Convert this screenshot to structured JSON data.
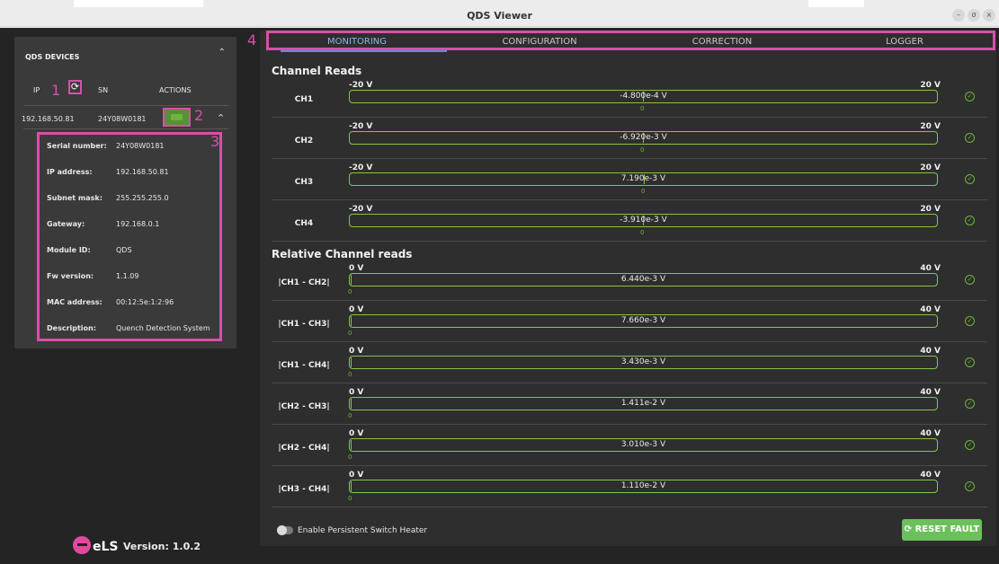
{
  "window": {
    "title": "QDS Viewer",
    "controls": [
      "–",
      "σ",
      "×"
    ]
  },
  "devices": {
    "header": "QDS DEVICES",
    "columns": {
      "ip": "IP",
      "sn": "SN",
      "actions": "ACTIONS"
    },
    "device": {
      "ip": "192.168.50.81",
      "sn": "24Y08W0181"
    },
    "details": [
      {
        "key": "Serial number:",
        "value": "24Y08W0181"
      },
      {
        "key": "IP address:",
        "value": "192.168.50.81"
      },
      {
        "key": "Subnet mask:",
        "value": "255.255.255.0"
      },
      {
        "key": "Gateway:",
        "value": "192.168.0.1"
      },
      {
        "key": "Module ID:",
        "value": "QDS"
      },
      {
        "key": "Fw version:",
        "value": "1.1.09"
      },
      {
        "key": "MAC address:",
        "value": "00:12:5e:1:2:96"
      },
      {
        "key": "Description:",
        "value": "Quench Detection System"
      }
    ]
  },
  "annotations": [
    "1",
    "2",
    "3",
    "4"
  ],
  "version": "Version: 1.0.2",
  "logo_text": "eLS",
  "tabs": [
    "MONITORING",
    "CONFIGURATION",
    "CORRECTION",
    "LOGGER"
  ],
  "active_tab": "MONITORING",
  "channel_reads": {
    "title": "Channel Reads",
    "rows": [
      {
        "name": "CH1",
        "min": "-20 V",
        "max": "20 V",
        "value": "-4.800e-4 V",
        "zero": "0",
        "level": 0.49999
      },
      {
        "name": "CH2",
        "min": "-20 V",
        "max": "20 V",
        "value": "-6.920e-3 V",
        "zero": "0",
        "level": 0.4998
      },
      {
        "name": "CH3",
        "min": "-20 V",
        "max": "20 V",
        "value": "7.190e-3 V",
        "zero": "0",
        "level": 0.5002
      },
      {
        "name": "CH4",
        "min": "-20 V",
        "max": "20 V",
        "value": "-3.910e-3 V",
        "zero": "0",
        "level": 0.4999
      }
    ]
  },
  "relative_reads": {
    "title": "Relative Channel reads",
    "rows": [
      {
        "name": "|CH1 - CH2|",
        "min": "0 V",
        "max": "40 V",
        "value": "6.440e-3 V",
        "zero": "0",
        "level": 0.0002
      },
      {
        "name": "|CH1 - CH3|",
        "min": "0 V",
        "max": "40 V",
        "value": "7.660e-3 V",
        "zero": "0",
        "level": 0.0002
      },
      {
        "name": "|CH1 - CH4|",
        "min": "0 V",
        "max": "40 V",
        "value": "3.430e-3 V",
        "zero": "0",
        "level": 0.0001
      },
      {
        "name": "|CH2 - CH3|",
        "min": "0 V",
        "max": "40 V",
        "value": "1.411e-2 V",
        "zero": "0",
        "level": 0.0004
      },
      {
        "name": "|CH2 - CH4|",
        "min": "0 V",
        "max": "40 V",
        "value": "3.010e-3 V",
        "zero": "0",
        "level": 0.0001
      },
      {
        "name": "|CH3 - CH4|",
        "min": "0 V",
        "max": "40 V",
        "value": "1.110e-2 V",
        "zero": "0",
        "level": 0.0003
      }
    ]
  },
  "persistent_switch_label": "Enable Persistent Switch Heater",
  "reset_label": "⟳ RESET FAULT",
  "colors": {
    "accent": "#d94fa9",
    "ok": "#6db43a",
    "tab_active": "#8fb6e8",
    "reset": "#6cc05b"
  }
}
